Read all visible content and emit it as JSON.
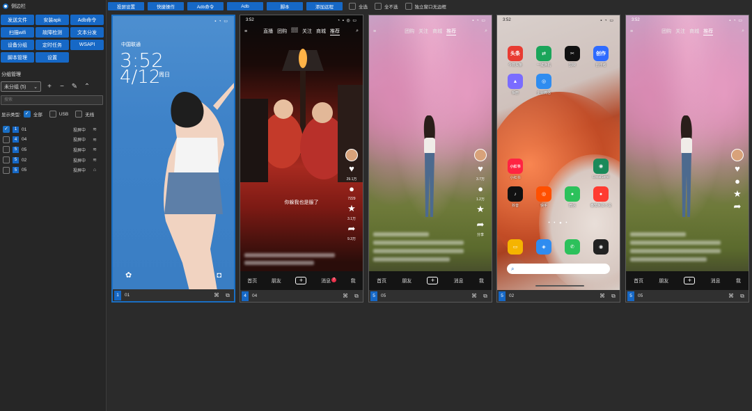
{
  "sidebar": {
    "toggle_label": "侧边栏",
    "buttons": [
      "发送文件",
      "安装apk",
      "Adb命令",
      "扫描wifi",
      "故障检测",
      "文本分发",
      "设备分组",
      "定时任务",
      "WSAPI",
      "脚本管理",
      "设置"
    ],
    "group_title": "分组管理",
    "group_select": "未分组 (5)",
    "search_placeholder": "搜索",
    "filter": {
      "label": "显示类型:",
      "all": "全部",
      "usb": "USB",
      "wireless": "无线"
    },
    "devices": [
      {
        "num": "1",
        "name": "01",
        "status": "投屏中",
        "icon": "wifi",
        "checked": true
      },
      {
        "num": "4",
        "name": "04",
        "status": "投屏中",
        "icon": "wifi",
        "checked": false
      },
      {
        "num": "5",
        "name": "05",
        "status": "投屏中",
        "icon": "wifi",
        "checked": false
      },
      {
        "num": "5",
        "name": "02",
        "status": "投屏中",
        "icon": "wifi",
        "checked": false
      },
      {
        "num": "5",
        "name": "05",
        "status": "投屏中",
        "icon": "usb",
        "checked": false
      }
    ]
  },
  "toolbar": {
    "buttons": [
      "投屏设置",
      "快捷操作",
      "Adb命令",
      "Adb",
      "脚本",
      "添加远程"
    ],
    "checks": [
      "全选",
      "全不选",
      "独立窗口无边框"
    ]
  },
  "cards": [
    {
      "num": "1",
      "name": "01",
      "type": "lock",
      "status_time": "",
      "status_right": "▪ ◔ ▭",
      "carrier": "中国联通",
      "time": "3:52",
      "date": "4/12",
      "weekday": "周日"
    },
    {
      "num": "4",
      "name": "04",
      "type": "drama",
      "status_time": "3:52",
      "status_right": "◔ ▪ ◎ ▭",
      "tabs": [
        "直播",
        "团购",
        "▒▒",
        "关注",
        "商城",
        "推荐"
      ],
      "subtitle": "你躲我也是服了",
      "rail": [
        "29.1万",
        "7229",
        "3.1万",
        "9.3万"
      ],
      "nav": [
        "首页",
        "朋友",
        "+",
        "消息",
        "我"
      ],
      "msg_badge": "7"
    },
    {
      "num": "5",
      "name": "05",
      "type": "blossom",
      "status_time": "",
      "status_right": "▪ ◔ ▭",
      "tabs": [
        "团购",
        "关注",
        "商城",
        "推荐"
      ],
      "rail": [
        "3.7万",
        "1.2万",
        "",
        "分享"
      ],
      "nav": [
        "首页",
        "朋友",
        "+",
        "消息",
        "我"
      ]
    },
    {
      "num": "5",
      "name": "02",
      "type": "home",
      "status_time": "3:52",
      "status_right": "▪ ◔ ▭",
      "apps_top": [
        {
          "label": "今日头条",
          "text": "头条",
          "color": "#e83b32"
        },
        {
          "label": "一键换机",
          "text": "⇄",
          "color": "#1aa55a"
        },
        {
          "label": "剪映",
          "text": "✂",
          "color": "#111111"
        },
        {
          "label": "创作者",
          "text": "创作",
          "color": "#2e6bff"
        },
        {
          "label": "相册",
          "text": "▲",
          "color": "#7a6cff"
        },
        {
          "label": "企业微信",
          "text": "◎",
          "color": "#2f8cf0"
        }
      ],
      "apps_mid": [
        {
          "label": "小红书",
          "text": "小红书",
          "color": "#ff2442"
        },
        {
          "label": "LocalSend",
          "text": "◉",
          "color": "#1b8a5a"
        },
        {
          "label": "抖音",
          "text": "♪",
          "color": "#111111"
        },
        {
          "label": "快手",
          "text": "◎",
          "color": "#ff5000"
        },
        {
          "label": "微信",
          "text": "●",
          "color": "#2cc15b"
        },
        {
          "label": "番茄免费小说",
          "text": "●",
          "color": "#ff3b30"
        }
      ],
      "dock": [
        {
          "text": "▭",
          "color": "#f5b400"
        },
        {
          "text": "◈",
          "color": "#2f8cf0"
        },
        {
          "text": "✆",
          "color": "#2cc15b"
        },
        {
          "text": "◉",
          "color": "#222222"
        }
      ]
    },
    {
      "num": "5",
      "name": "05",
      "type": "blossom",
      "status_time": "3:52",
      "status_right": "▪ ◔ ▭",
      "tabs": [
        "团购",
        "关注",
        "商城",
        "推荐"
      ],
      "rail": [
        "",
        "",
        "",
        ""
      ],
      "nav": [
        "首页",
        "朋友",
        "+",
        "消息",
        "我"
      ]
    }
  ],
  "icons": {
    "wifi": "wifi-icon",
    "usb": "usb-icon",
    "plus": "plus-icon",
    "minus": "minus-icon",
    "edit": "pencil-icon",
    "collapse": "chevron-up-icon",
    "dropdown": "chevron-down-icon",
    "link": "link-icon",
    "external": "external-link-icon"
  },
  "colors": {
    "accent": "#1668c6",
    "panel": "#262626",
    "bg": "#2b2b2b"
  }
}
